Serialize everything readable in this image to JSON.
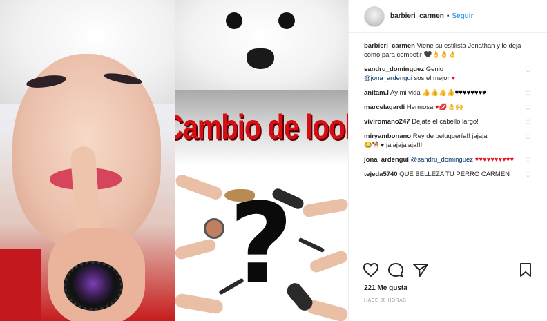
{
  "colors": {
    "link": "#3897f0",
    "mention": "#003569",
    "banner_red": "#d40e14",
    "heart_red": "#e0111d"
  },
  "images": {
    "banner_text": "Cambio de look",
    "question_mark": "?"
  },
  "header": {
    "username": "barbieri_carmen",
    "separator": "•",
    "follow_label": "Seguir"
  },
  "caption": {
    "user": "barbieri_carmen",
    "text": "Viene su estilista Jonathan y lo deja como para competir",
    "emoji": "🖤👌👌👌"
  },
  "comments": [
    {
      "user": "sandru_dominguez",
      "text": "Genio",
      "mention": "@jona_ardengui",
      "text2": "sos el mejor",
      "emoji": "♥"
    },
    {
      "user": "anitam.l",
      "text": "Ay mi vida",
      "emoji": "👍👍👍👍♥♥♥♥♥♥♥♥"
    },
    {
      "user": "marcelagardi",
      "text": "Hermosa",
      "emoji": "♥💋👌🙌"
    },
    {
      "user": "viviromano247",
      "text": "Dejate el cabello largo!",
      "emoji": ""
    },
    {
      "user": "miryambonano",
      "text": "Rey de peluquería!! jajaja",
      "emoji": "😂🐕♥",
      "text2": "jajajajajaja!!!"
    },
    {
      "user": "jona_ardengui",
      "mention": "@sandru_dominguez",
      "emoji": "♥♥♥♥♥♥♥♥♥♥"
    },
    {
      "user": "tejeda5740",
      "text": "QUE BELLEZA TU PERRO CARMEN",
      "emoji": ""
    }
  ],
  "icons": {
    "comment_like": "heart-outline-icon",
    "like": "heart-outline-icon",
    "comment": "speech-bubble-icon",
    "share": "paper-plane-icon",
    "save": "bookmark-icon"
  },
  "likes": "221 Me gusta",
  "time": "HACE 20 HORAS"
}
